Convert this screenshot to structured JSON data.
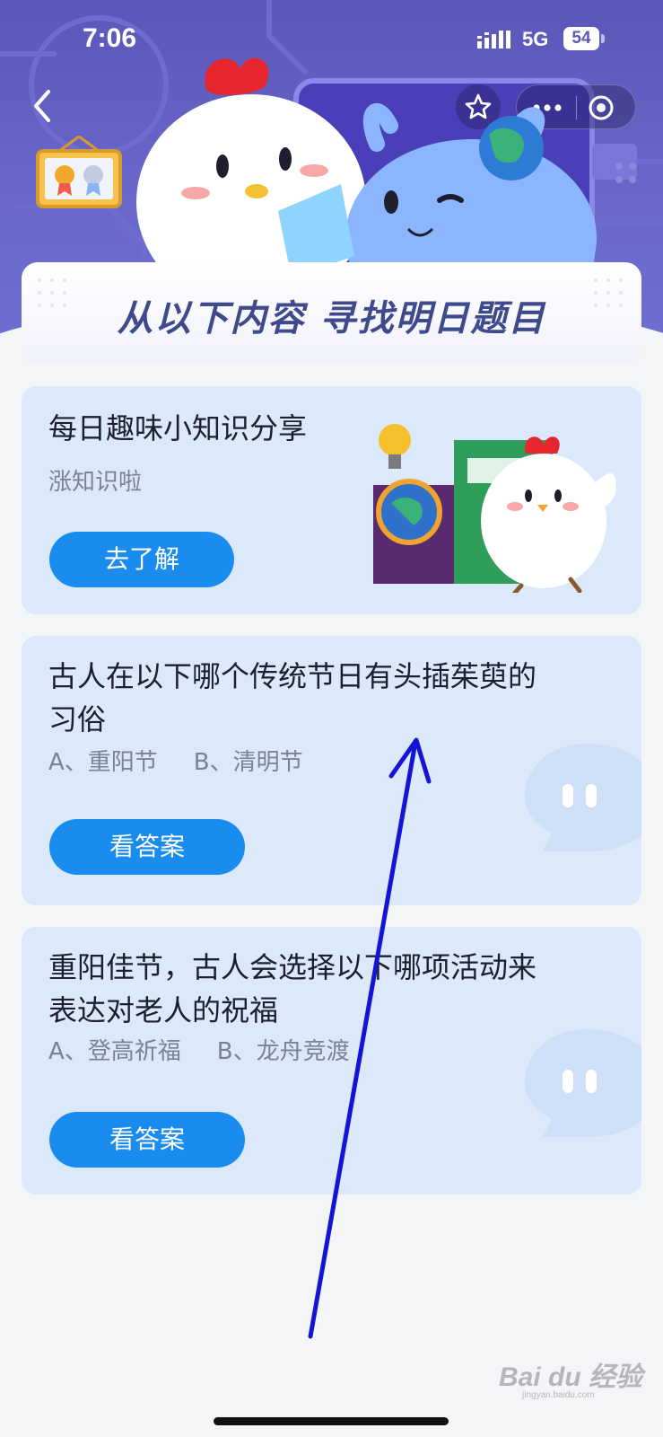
{
  "status_bar": {
    "time": "7:06",
    "network": "5G",
    "battery": "54"
  },
  "header": {
    "banner_title": "从以下内容  寻找明日题目"
  },
  "cards": [
    {
      "title": "每日趣味小知识分享",
      "subtitle": "涨知识啦",
      "button": "去了解"
    },
    {
      "question_line1": "古人在以下哪个传统节日有头插茱萸的",
      "question_line2": "习俗",
      "option_a": "A、重阳节",
      "option_b": "B、清明节",
      "button": "看答案"
    },
    {
      "question_line1": "重阳佳节，古人会选择以下哪项活动来",
      "question_line2": "表达对老人的祝福",
      "option_a": "A、登高祈福",
      "option_b": "B、龙舟竞渡",
      "button": "看答案"
    }
  ],
  "watermark": {
    "brand": "Bai du 经验",
    "url": "jingyan.baidu.com"
  },
  "colors": {
    "header": "#5b57b9",
    "card_bg": "#dce9fb",
    "button": "#1a8cf0",
    "annotation_arrow": "#1414d6"
  }
}
